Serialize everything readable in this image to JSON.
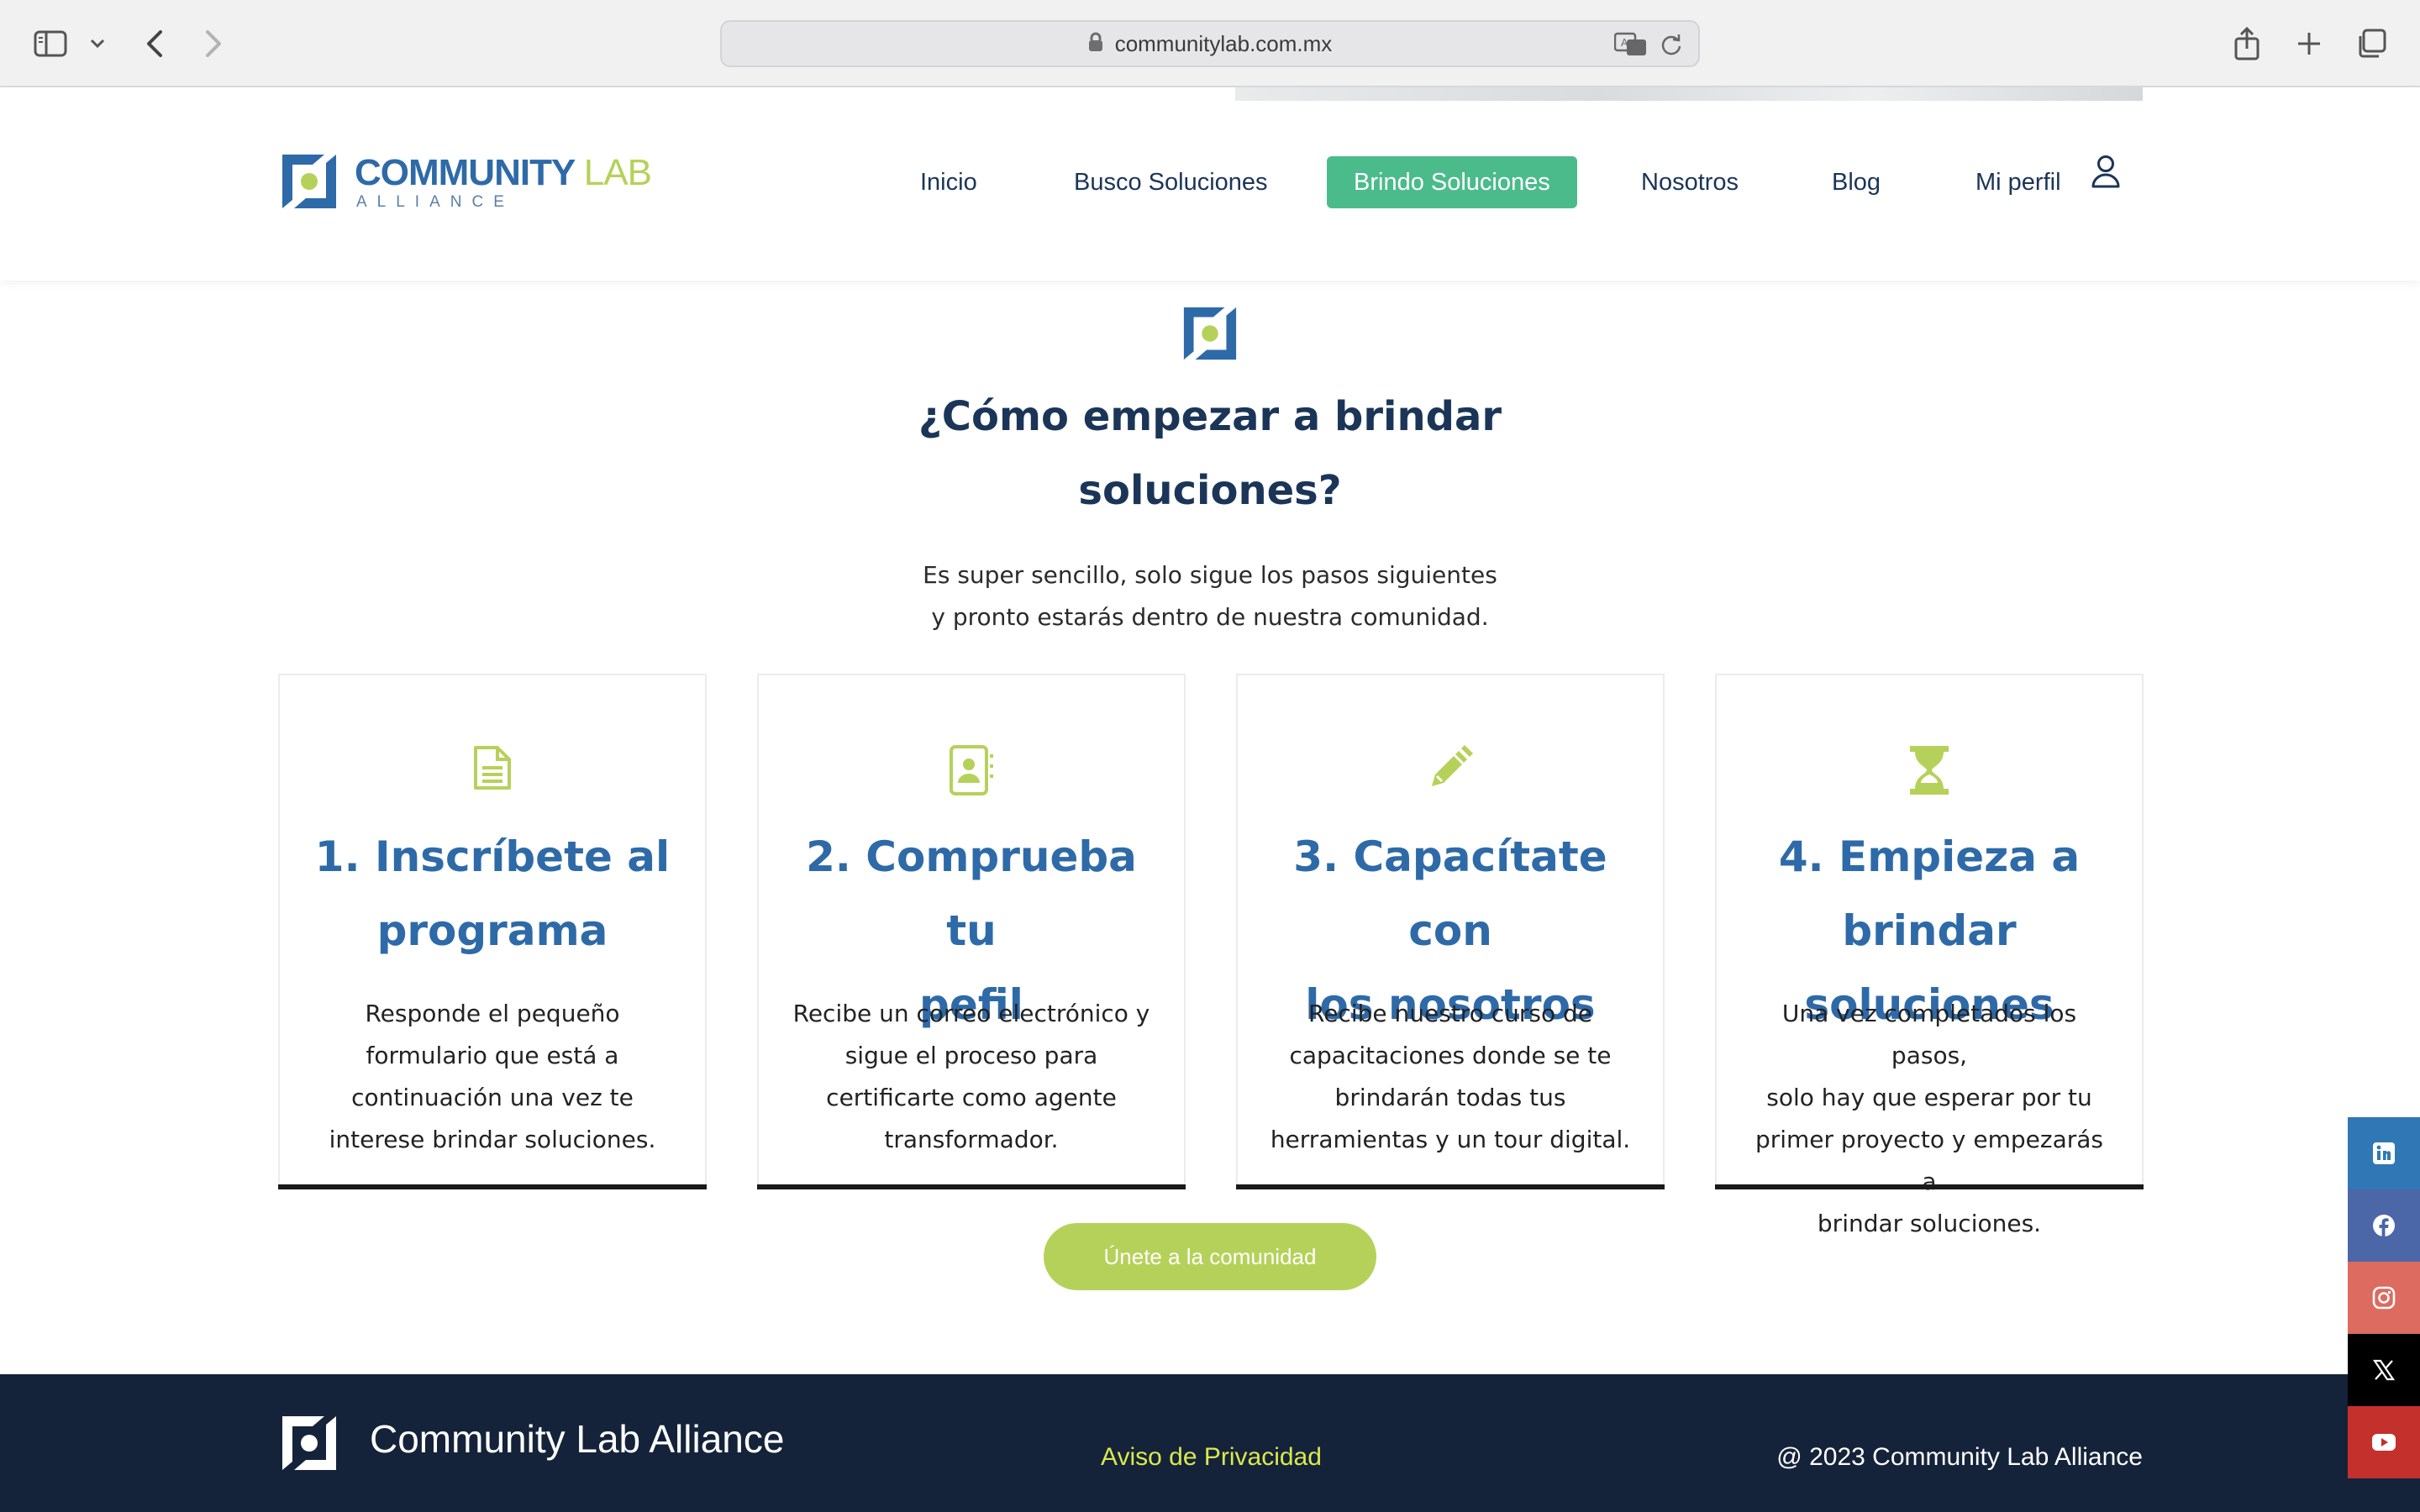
{
  "browser": {
    "url": "communitylab.com.mx",
    "icons": [
      "sidebar-icon",
      "chevron-down-icon",
      "back-icon",
      "forward-icon",
      "lock-icon",
      "translate-icon",
      "reload-icon",
      "share-icon",
      "new-tab-icon",
      "tabs-overview-icon"
    ]
  },
  "brand": {
    "name_part1": "COMMUNITY",
    "name_part2": "LAB",
    "tagline": "ALLIANCE",
    "colors": {
      "blue": "#2e6aa8",
      "green": "#b6d15a",
      "nav_active": "#4cbb8c",
      "footer": "#14233a"
    }
  },
  "nav": {
    "items": [
      {
        "label": "Inicio",
        "active": false
      },
      {
        "label": "Busco Soluciones",
        "active": false
      },
      {
        "label": "Brindo Soluciones",
        "active": true
      },
      {
        "label": "Nosotros",
        "active": false
      },
      {
        "label": "Blog",
        "active": false
      },
      {
        "label": "Mi perfil",
        "active": false
      }
    ]
  },
  "section": {
    "title_line1": "¿Cómo empezar a brindar",
    "title_line2": "soluciones?",
    "subtitle_line1": "Es super sencillo, solo sigue los pasos siguientes",
    "subtitle_line2": "y pronto estarás dentro de nuestra comunidad."
  },
  "steps": [
    {
      "icon": "document-icon",
      "title_line1": "1. Inscríbete al",
      "title_line2": "programa",
      "desc": [
        "Responde el pequeño",
        "formulario que está a",
        "continuación una vez te",
        "interese brindar soluciones."
      ]
    },
    {
      "icon": "contact-card-icon",
      "title_line1": "2. Comprueba tu",
      "title_line2": "pefil",
      "desc": [
        "Recibe un correo electrónico y",
        "sigue el proceso para",
        "certificarte como agente",
        "transformador."
      ]
    },
    {
      "icon": "pencil-icon",
      "title_line1": "3. Capacítate con",
      "title_line2": "los nosotros",
      "desc": [
        "Recibe nuestro curso de",
        "capacitaciones donde se te",
        "brindarán todas tus",
        "herramientas y un tour digital."
      ]
    },
    {
      "icon": "hourglass-icon",
      "title_line1": "4. Empieza a",
      "title_line2": "brindar soluciones",
      "desc": [
        "Una vez completados los pasos,",
        "solo hay que esperar por tu",
        "primer proyecto y empezarás a",
        "brindar soluciones."
      ]
    }
  ],
  "cta": {
    "label": "Únete a la comunidad"
  },
  "footer": {
    "name": "Community Lab Alliance",
    "privacy": "Aviso de Privacidad",
    "copyright": "@ 2023 Community Lab Alliance"
  },
  "social": [
    {
      "icon": "linkedin-icon",
      "color": "#2f78b5"
    },
    {
      "icon": "facebook-icon",
      "color": "#4b67a8"
    },
    {
      "icon": "instagram-icon",
      "color": "#dd6b5f"
    },
    {
      "icon": "x-icon",
      "color": "#000000"
    },
    {
      "icon": "youtube-icon",
      "color": "#c4302b"
    }
  ]
}
